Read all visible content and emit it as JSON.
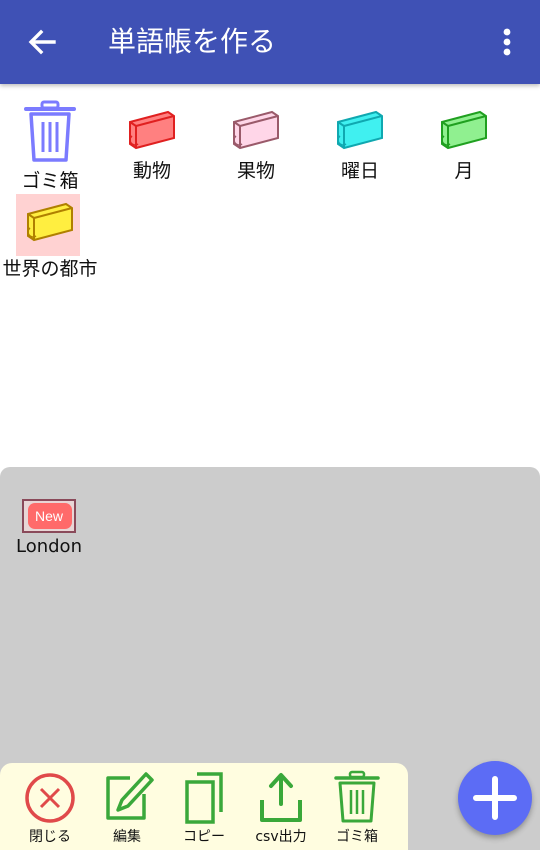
{
  "appbar": {
    "title": "単語帳を作る",
    "bg_color": "#3f51b5"
  },
  "books": [
    {
      "label": "ゴミ箱",
      "icon": "trash-icon",
      "color": "#7b7bff"
    },
    {
      "label": "動物",
      "icon": "book-icon",
      "color": "#ff8080"
    },
    {
      "label": "果物",
      "icon": "book-icon",
      "color": "#ffd6e8"
    },
    {
      "label": "曜日",
      "icon": "book-icon",
      "color": "#40f0f0"
    },
    {
      "label": "月",
      "icon": "book-icon",
      "color": "#90f090"
    },
    {
      "label": "世界の都市",
      "icon": "book-icon",
      "color": "#ffee40",
      "selected": true
    }
  ],
  "cards": [
    {
      "badge": "New",
      "label": "London"
    }
  ],
  "toolbar": {
    "close_label": "閉じる",
    "edit_label": "編集",
    "copy_label": "コピー",
    "export_label": "csv出力",
    "trash_label": "ゴミ箱"
  },
  "fab_icon": "plus-icon"
}
